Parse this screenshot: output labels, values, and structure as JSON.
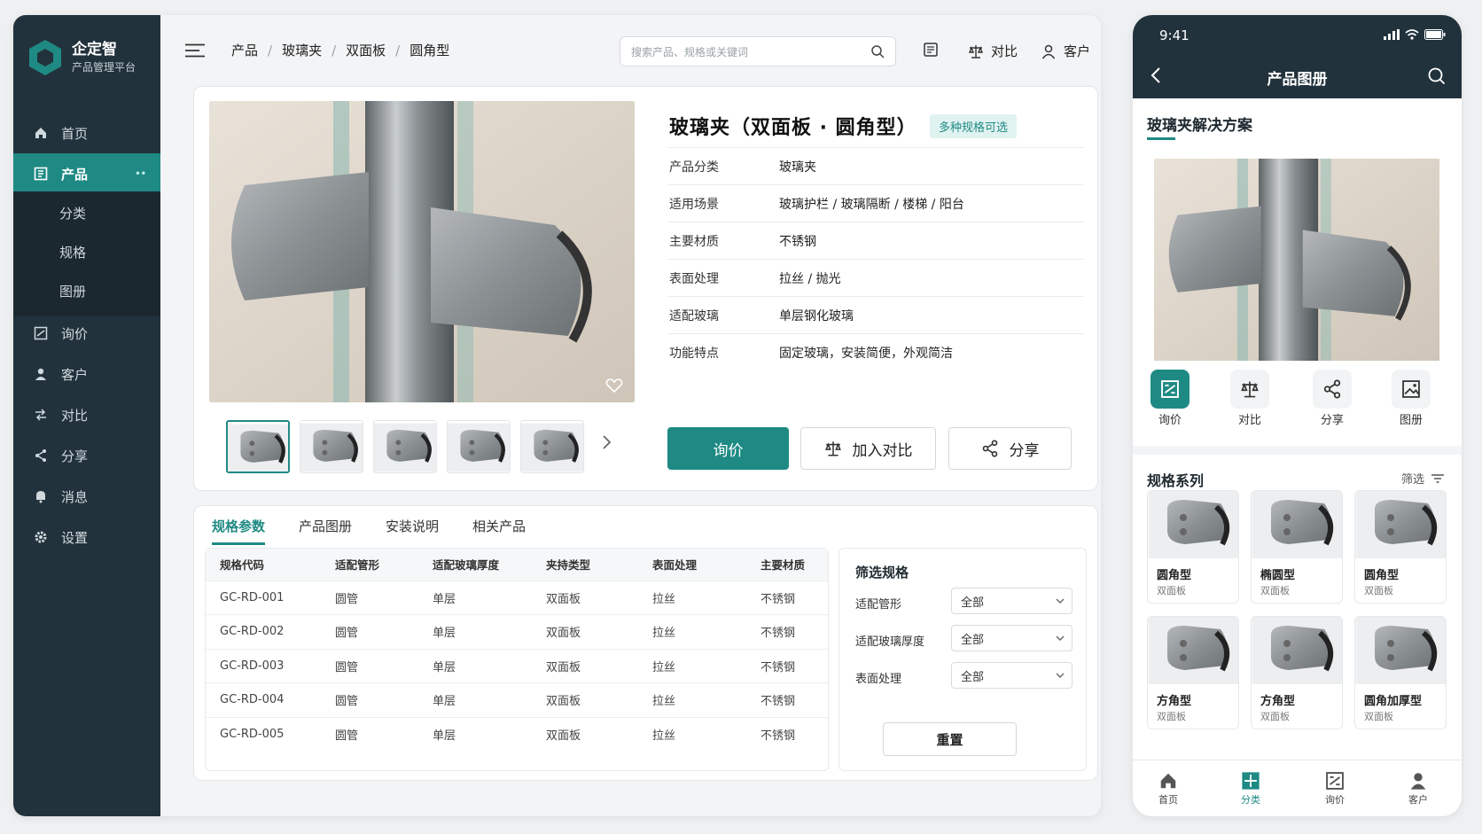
{
  "brand": {
    "name": "企定智",
    "subtitle": "产品管理平台"
  },
  "sidebar": {
    "items": [
      {
        "label": "首页",
        "icon": "home-icon"
      },
      {
        "label": "产品",
        "icon": "product-icon",
        "badge": "••"
      },
      {
        "label": "询价",
        "icon": "inquiry-icon"
      },
      {
        "label": "客户",
        "icon": "customer-icon"
      },
      {
        "label": "对比",
        "icon": "compare-icon"
      },
      {
        "label": "分享",
        "icon": "share-icon"
      },
      {
        "label": "消息",
        "icon": "message-icon"
      },
      {
        "label": "设置",
        "icon": "settings-icon"
      }
    ],
    "sub": [
      "分类",
      "规格",
      "图册"
    ]
  },
  "header": {
    "breadcrumb": [
      "产品",
      "玻璃夹",
      "双面板",
      "圆角型"
    ],
    "search_placeholder": "搜索产品、规格或关键词",
    "compare": "对比",
    "customer": "客户"
  },
  "product": {
    "title": "玻璃夹（双面板 · 圆角型）",
    "badge": "多种规格可选",
    "specs": [
      {
        "k": "产品分类",
        "v": "玻璃夹"
      },
      {
        "k": "适用场景",
        "v": "玻璃护栏 / 玻璃隔断 / 楼梯 / 阳台"
      },
      {
        "k": "主要材质",
        "v": "不锈钢"
      },
      {
        "k": "表面处理",
        "v": "拉丝 / 抛光"
      },
      {
        "k": "适配玻璃",
        "v": "单层钢化玻璃"
      },
      {
        "k": "功能特点",
        "v": "固定玻璃，安装简便，外观简洁"
      }
    ],
    "actions": {
      "inquiry": "询价",
      "compare": "加入对比",
      "share": "分享"
    }
  },
  "tabs": [
    "规格参数",
    "产品图册",
    "安装说明",
    "相关产品"
  ],
  "table": {
    "headers": [
      "规格代码",
      "适配管形",
      "适配玻璃厚度",
      "夹持类型",
      "表面处理",
      "主要材质"
    ],
    "rows": [
      [
        "GC-RD-001",
        "圆管",
        "单层",
        "双面板",
        "拉丝",
        "不锈钢"
      ],
      [
        "GC-RD-002",
        "圆管",
        "单层",
        "双面板",
        "拉丝",
        "不锈钢"
      ],
      [
        "GC-RD-003",
        "圆管",
        "单层",
        "双面板",
        "拉丝",
        "不锈钢"
      ],
      [
        "GC-RD-004",
        "圆管",
        "单层",
        "双面板",
        "拉丝",
        "不锈钢"
      ],
      [
        "GC-RD-005",
        "圆管",
        "单层",
        "双面板",
        "拉丝",
        "不锈钢"
      ]
    ]
  },
  "filter": {
    "title": "筛选规格",
    "rows": [
      {
        "label": "适配管形",
        "value": "全部"
      },
      {
        "label": "适配玻璃厚度",
        "value": "全部"
      },
      {
        "label": "表面处理",
        "value": "全部"
      }
    ],
    "reset": "重置"
  },
  "phone": {
    "time": "9:41",
    "title": "产品图册",
    "section": "玻璃夹解决方案",
    "quick": [
      "询价",
      "对比",
      "分享",
      "图册"
    ],
    "spec_title": "规格系列",
    "filter": "筛选",
    "cards": [
      {
        "n1": "圆角型",
        "n2": "双面板"
      },
      {
        "n1": "椭圆型",
        "n2": "双面板"
      },
      {
        "n1": "圆角型",
        "n2": "双面板"
      },
      {
        "n1": "方角型",
        "n2": "双面板"
      },
      {
        "n1": "方角型",
        "n2": "双面板"
      },
      {
        "n1": "圆角加厚型",
        "n2": "双面板"
      }
    ],
    "tabbar": [
      "首页",
      "分类",
      "询价",
      "客户"
    ]
  },
  "colors": {
    "accent": "#1f8a84",
    "sidebar": "#22323c"
  }
}
